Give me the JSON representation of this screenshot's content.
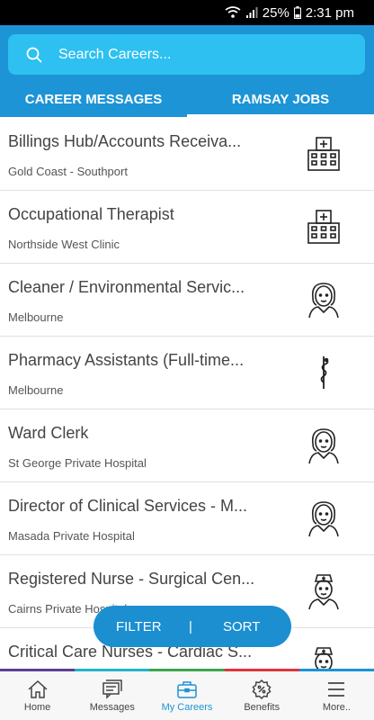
{
  "status": {
    "battery": "25%",
    "time": "2:31 pm"
  },
  "search": {
    "placeholder": "Search Careers..."
  },
  "tabs": [
    {
      "label": "CAREER MESSAGES"
    },
    {
      "label": "RAMSAY JOBS",
      "active": true
    }
  ],
  "jobs": [
    {
      "title": "Billings Hub/Accounts Receiva...",
      "location": "Gold Coast - Southport",
      "icon": "hospital-icon"
    },
    {
      "title": "Occupational Therapist",
      "location": "Northside West Clinic",
      "icon": "hospital-icon"
    },
    {
      "title": "Cleaner / Environmental Servic...",
      "location": "Melbourne",
      "icon": "staff-icon"
    },
    {
      "title": "Pharmacy Assistants (Full-time...",
      "location": "Melbourne",
      "icon": "caduceus-icon"
    },
    {
      "title": "Ward Clerk",
      "location": "St George Private Hospital",
      "icon": "staff-icon"
    },
    {
      "title": "Director of Clinical Services - M...",
      "location": "Masada Private Hospital",
      "icon": "staff-icon"
    },
    {
      "title": "Registered Nurse - Surgical Cen...",
      "location": "Cairns Private Hospital",
      "icon": "nurse-icon"
    },
    {
      "title": "Critical Care Nurses - Cardiac S...",
      "location": "",
      "icon": "nurse-icon"
    }
  ],
  "actions": {
    "filter": "FILTER",
    "separator": "|",
    "sort": "SORT"
  },
  "accent_colors": [
    "#5b3f95",
    "#1fb5c9",
    "#3aa54c",
    "#e0353d",
    "#1d94d6"
  ],
  "nav": [
    {
      "label": "Home",
      "icon": "home-icon"
    },
    {
      "label": "Messages",
      "icon": "messages-icon"
    },
    {
      "label": "My Careers",
      "icon": "briefcase-icon",
      "active": true
    },
    {
      "label": "Benefits",
      "icon": "benefits-icon"
    },
    {
      "label": "More..",
      "icon": "menu-icon"
    }
  ],
  "colors": {
    "header": "#1d94d6",
    "search": "#2dc0f1",
    "pill": "#1b8fd0"
  }
}
